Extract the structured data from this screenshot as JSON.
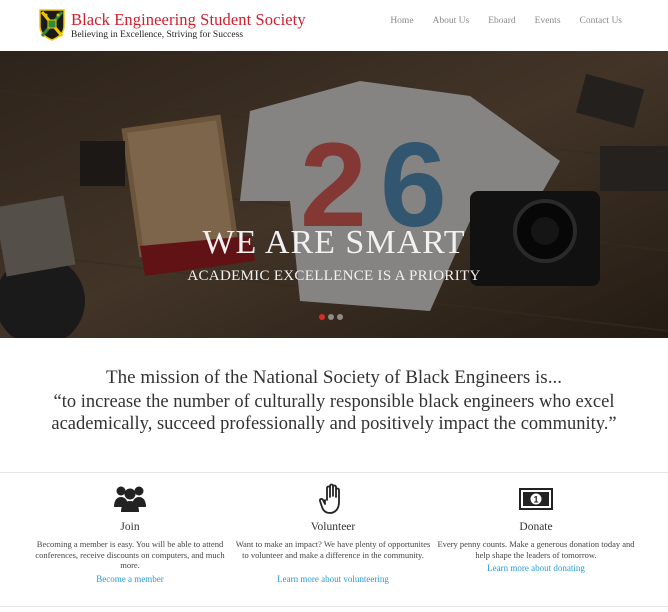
{
  "header": {
    "title": "Black Engineering Student Society",
    "tagline": "Believing in Excellence, Striving for Success",
    "nav": [
      "Home",
      "About Us",
      "Eboard",
      "Events",
      "Contact Us"
    ]
  },
  "hero": {
    "title": "WE ARE SMART",
    "subtitle": "ACADEMIC EXCELLENCE IS A PRIORITY",
    "slide_count": 3,
    "active_slide": 1
  },
  "mission": {
    "lead": "The mission of the National Society of Black Engineers is...",
    "quote": "“to increase the number of culturally responsible black engineers who excel academically, succeed professionally and positively impact the community.”"
  },
  "columns": [
    {
      "icon": "group-icon",
      "title": "Join",
      "text": "Becoming a member is easy. You will be able to attend conferences, receive discounts on computers, and much more.",
      "link": "Become a member"
    },
    {
      "icon": "raised-hand-icon",
      "title": "Volunteer",
      "text": "Want to make an impact? We have plenty of opportunites to volunteer and make a difference in the community.",
      "link": "Learn more about volunteering"
    },
    {
      "icon": "dollar-bill-icon",
      "title": "Donate",
      "text": "Every penny counts. Make a generous donation today and help shape the leaders of tomorrow.",
      "link": "Learn more about donating"
    }
  ],
  "colors": {
    "brand_red": "#d21d2c",
    "link_blue": "#2a9bd3",
    "nav_gray": "#8a8a8a",
    "active_dot": "#d92a2a"
  }
}
